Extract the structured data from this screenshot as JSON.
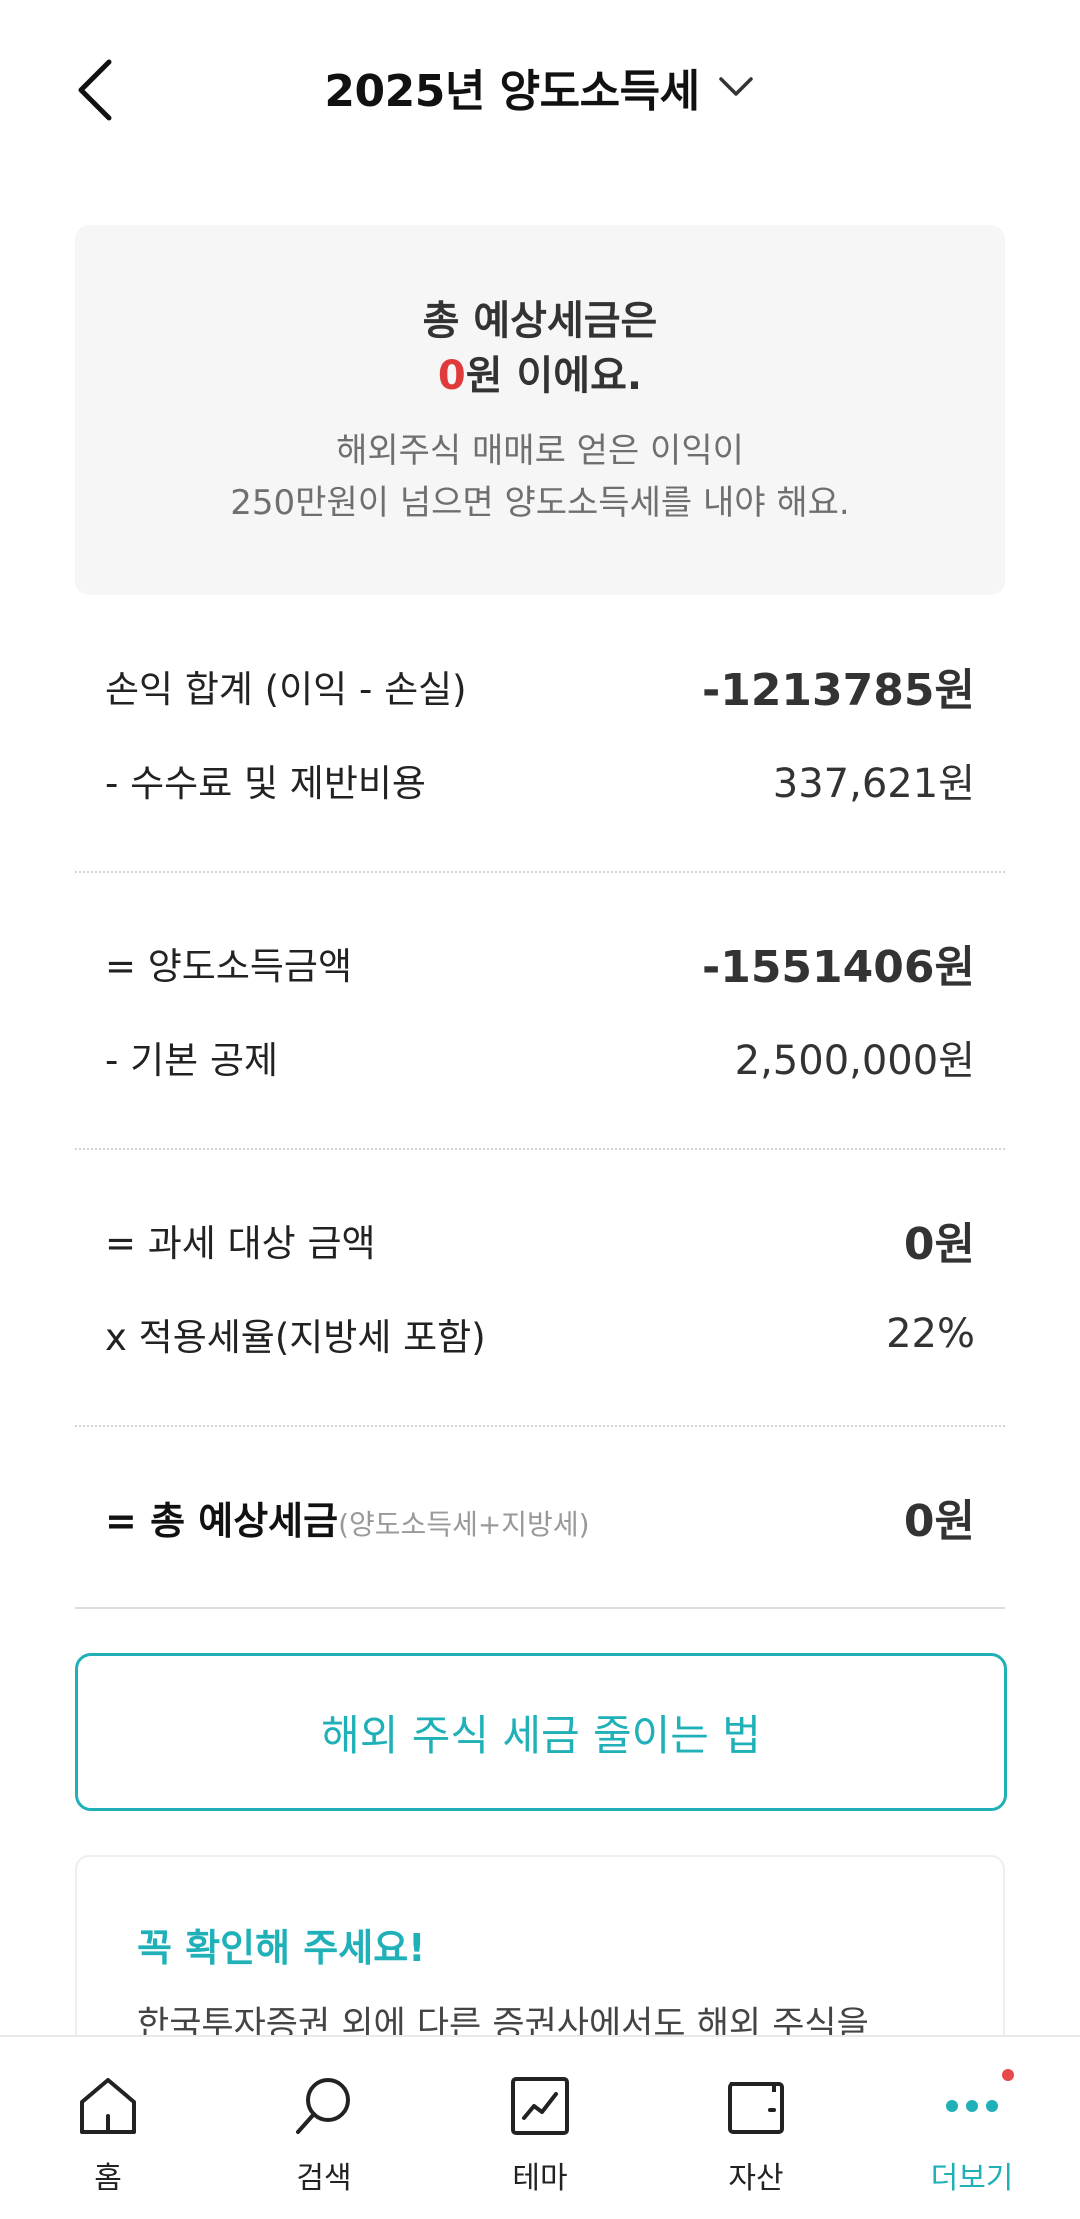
{
  "header": {
    "title": "2025년 양도소득세"
  },
  "summary": {
    "line1": "총 예상세금은",
    "amount": "0",
    "line2_rest": "원 이에요.",
    "desc_line1": "해외주식 매매로 얻은 이익이",
    "desc_line2": "250만원이 넘으면 양도소득세를 내야 해요."
  },
  "rows": {
    "profit_sum": {
      "label": "손익 합계 (이익 - 손실)",
      "value": "-1213785원"
    },
    "fees": {
      "label": "- 수수료 및 제반비용",
      "value": "337,621원"
    },
    "transfer_income": {
      "label": "= 양도소득금액",
      "value": "-1551406원"
    },
    "basic_deduction": {
      "label": "- 기본 공제",
      "value": "2,500,000원"
    },
    "taxable_amount": {
      "label": "= 과세 대상 금액",
      "value": "0원"
    },
    "tax_rate": {
      "label": "x 적용세율(지방세 포함)",
      "value": "22%"
    },
    "total": {
      "label": "= 총 예상세금",
      "sub": "(양도소득세+지방세)",
      "value": "0원"
    }
  },
  "tips_button": {
    "label": "해외 주식 세금 줄이는 법"
  },
  "notice": {
    "title": "꼭 확인해 주세요!",
    "body": "한국투자증권 외에 다른 증권사에서도 해외 주식을"
  },
  "bottom_nav": {
    "items": [
      {
        "label": "홈",
        "icon": "home-icon"
      },
      {
        "label": "검색",
        "icon": "search-icon"
      },
      {
        "label": "테마",
        "icon": "chart-icon"
      },
      {
        "label": "자산",
        "icon": "wallet-icon"
      },
      {
        "label": "더보기",
        "icon": "more-icon",
        "active": true
      }
    ]
  },
  "colors": {
    "accent": "#1fb0b8",
    "highlight_red": "#e03b3b",
    "badge": "#e84a4a"
  }
}
